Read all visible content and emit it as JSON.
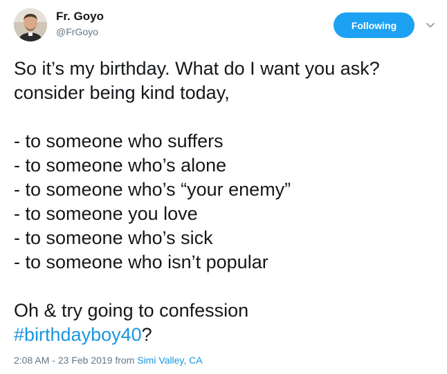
{
  "author": {
    "display_name": "Fr. Goyo",
    "handle": "@FrGoyo",
    "avatar_icon": "profile-photo"
  },
  "follow_button": {
    "label": "Following",
    "color": "#1da1f2"
  },
  "more_menu": {
    "icon": "chevron-down-icon"
  },
  "tweet": {
    "intro_line_1": "So it’s my birthday. What do I want you ask?",
    "intro_line_2": "consider being kind today,",
    "list": [
      "- to someone who suffers",
      "- to someone who’s alone",
      "- to someone who’s “your enemy”",
      "- to someone you love",
      "- to someone who’s sick",
      "- to someone who isn’t popular"
    ],
    "closing_line": "Oh & try going to confession",
    "hashtag": "#birthdayboy40",
    "after_hashtag": "?"
  },
  "meta": {
    "time": "2:08 AM",
    "separator": " - ",
    "date": "23 Feb 2019",
    "from_label": " from ",
    "location": "Simi Valley, CA"
  },
  "colors": {
    "link": "#1b95e0",
    "secondary_text": "#657786",
    "primary_text": "#14171a"
  }
}
